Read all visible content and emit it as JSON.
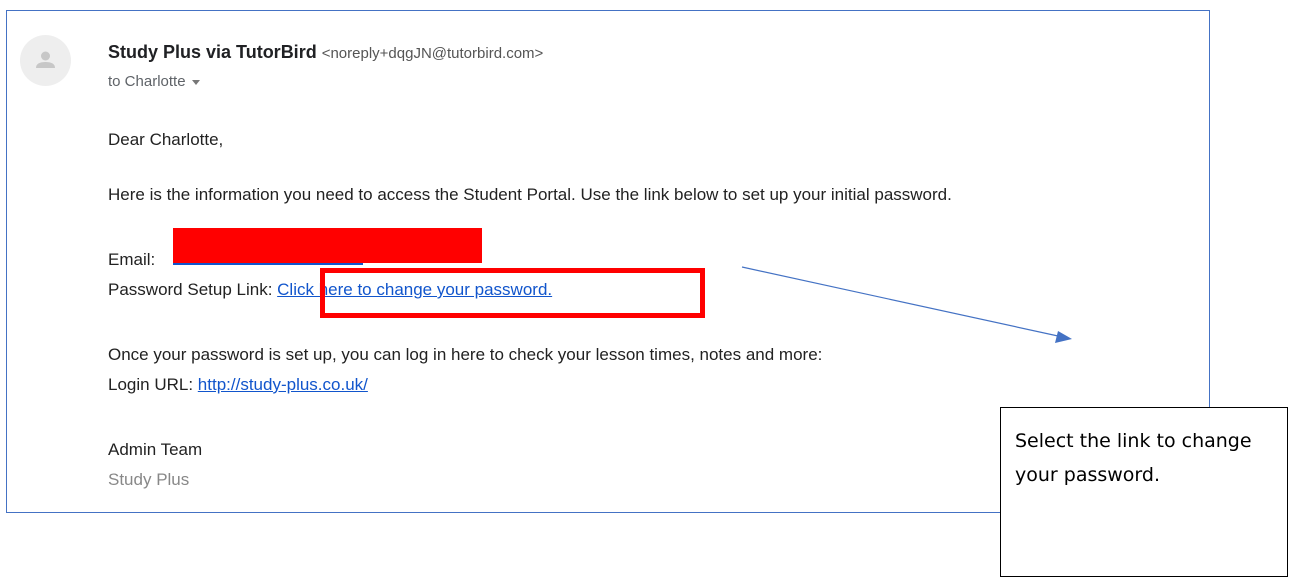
{
  "email": {
    "sender_name": "Study Plus via TutorBird",
    "sender_email": "<noreply+dqgJN@tutorbird.com>",
    "recipient": "to Charlotte",
    "greeting": "Dear Charlotte,",
    "intro": "Here is the information you need to access the Student Portal. Use the link below to set up your initial password.",
    "email_label": "Email:",
    "setup_label": "Password Setup Link:",
    "setup_link": "Click here to change your password.",
    "login_intro": "Once your password is set up, you can log in here to check your lesson times, notes and more:",
    "login_label": "Login URL:",
    "login_url": "http://study-plus.co.uk/",
    "sign_team": "Admin Team",
    "sign_company": "Study Plus"
  },
  "annotation": {
    "callout_text": "Select the link to change your password.",
    "highlight_color": "#ff0000",
    "arrow_color": "#4472c4"
  },
  "icons": {
    "avatar": "person-icon",
    "recipient_dropdown": "caret-down-icon"
  }
}
